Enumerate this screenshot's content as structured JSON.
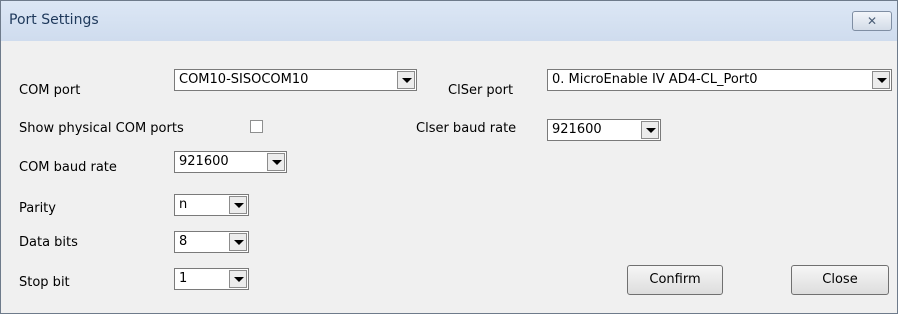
{
  "window": {
    "title": "Port Settings",
    "close_glyph": "✕"
  },
  "com_port": {
    "label": "COM port",
    "value": "COM10-SISOCOM10"
  },
  "show_physical": {
    "label": "Show physical COM ports",
    "checked": false
  },
  "com_baud": {
    "label": "COM baud rate",
    "value": "921600"
  },
  "parity": {
    "label": "Parity",
    "value": "n"
  },
  "data_bits": {
    "label": "Data bits",
    "value": "8"
  },
  "stop_bit": {
    "label": "Stop bit",
    "value": "1"
  },
  "clser_port": {
    "label": "ClSer port",
    "value": "0. MicroEnable IV AD4-CL_Port0"
  },
  "clser_baud": {
    "label": "Clser baud rate",
    "value": "921600"
  },
  "buttons": {
    "confirm": "Confirm",
    "close": "Close"
  }
}
